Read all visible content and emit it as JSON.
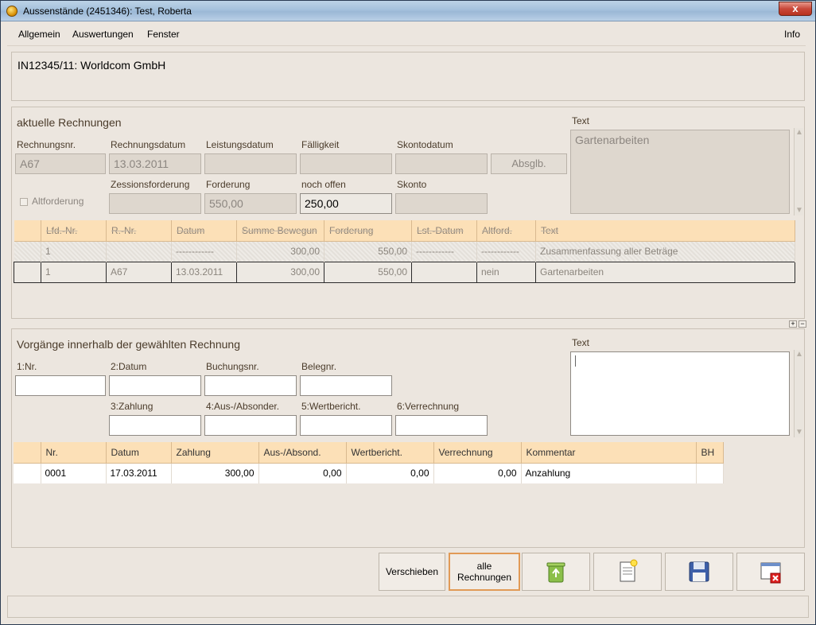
{
  "window": {
    "title": "Aussenstände (2451346): Test, Roberta",
    "close_label": "x"
  },
  "menu": {
    "items": [
      "Allgemein",
      "Auswertungen",
      "Fenster"
    ],
    "info": "Info"
  },
  "header": {
    "text": "IN12345/11: Worldcom GmbH"
  },
  "invoices": {
    "section_title": "aktuelle Rechnungen",
    "labels": {
      "rechnungsnr": "Rechnungsnr.",
      "rechnungsdatum": "Rechnungsdatum",
      "leistungsdatum": "Leistungsdatum",
      "faelligkeit": "Fälligkeit",
      "skontodatum": "Skontodatum",
      "zessionsforderung": "Zessionsforderung",
      "forderung": "Forderung",
      "noch_offen": "noch offen",
      "skonto": "Skonto",
      "altforderung": "Altforderung",
      "text": "Text"
    },
    "values": {
      "rechnungsnr": "A67",
      "rechnungsdatum": "13.03.2011",
      "leistungsdatum": "",
      "faelligkeit": "",
      "skontodatum": "",
      "zessionsforderung": "",
      "forderung": "550,00",
      "noch_offen": "250,00",
      "skonto": "",
      "text": "Gartenarbeiten"
    },
    "absglb_label": "Absglb.",
    "table": {
      "columns": [
        "",
        "Lfd.-Nr.",
        "R.-Nr.",
        "Datum",
        "Summe Bewegun",
        "Forderung",
        "Lst.-Datum",
        "Altford.",
        "Text"
      ],
      "rows": [
        [
          "",
          "1",
          "",
          "------------",
          "300,00",
          "550,00",
          "------------",
          "------------",
          "Zusammenfassung aller Beträge"
        ],
        [
          "",
          "1",
          "A67",
          "13.03.2011",
          "300,00",
          "550,00",
          "",
          "nein",
          "Gartenarbeiten"
        ]
      ]
    }
  },
  "transactions": {
    "section_title": "Vorgänge innerhalb der gewählten Rechnung",
    "labels": {
      "nr": "1:Nr.",
      "datum": "2:Datum",
      "buchungsnr": "Buchungsnr.",
      "belegnr": "Belegnr.",
      "zahlung": "3:Zahlung",
      "aus_absonder": "4:Aus-/Absonder.",
      "wertbericht": "5:Wertbericht.",
      "verrechnung": "6:Verrechnung",
      "text": "Text"
    },
    "table": {
      "columns": [
        "",
        "Nr.",
        "Datum",
        "Zahlung",
        "Aus-/Absond.",
        "Wertbericht.",
        "Verrechnung",
        "Kommentar",
        "BH"
      ],
      "rows": [
        [
          "",
          "0001",
          "17.03.2011",
          "300,00",
          "0,00",
          "0,00",
          "0,00",
          "Anzahlung",
          ""
        ]
      ]
    }
  },
  "buttons": {
    "verschieben": "Verschieben",
    "alle_rechnungen_1": "alle",
    "alle_rechnungen_2": "Rechnungen"
  },
  "colors": {
    "header_bg": "#fce0b7",
    "active_button_border": "#e19a56",
    "window_bg": "#ece6df"
  }
}
